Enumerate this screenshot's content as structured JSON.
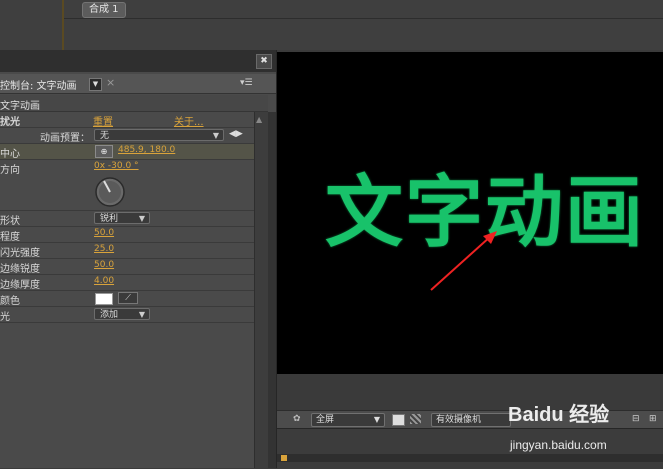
{
  "composition_tab": {
    "label": "合成 1"
  },
  "effect_panel": {
    "title": "控制台: 文字动画",
    "layer": "文字动画",
    "effect_name": "扰光",
    "reset_label": "重置",
    "about_label": "关于...",
    "preset_label": "动画预置：",
    "preset_value": "无",
    "rows": {
      "center_label": "中心",
      "center_value": "485.9, 180.0",
      "direction_label": "方向",
      "direction_value": "0x -30.0 °",
      "shape_label": "形状",
      "shape_value": "锐利",
      "sharpness_label": "程度",
      "sharpness_value": "50.0",
      "light_label": "闪光强度",
      "light_value": "25.0",
      "edge_sharp_label": "边缘锐度",
      "edge_sharp_value": "50.0",
      "edge_thick_label": "边缘厚度",
      "edge_thick_value": "4.00",
      "color_label": "颜色",
      "color_swatch": "#ffffff",
      "blend_label": "光",
      "blend_value": "添加"
    }
  },
  "viewer": {
    "text": "文字动画",
    "text_color": "#18c26a",
    "toolbar": {
      "zoom": "全屏",
      "camera": "有效摄像机"
    }
  },
  "watermark": {
    "brand": "Baidu 经验",
    "url": "jingyan.baidu.com"
  }
}
